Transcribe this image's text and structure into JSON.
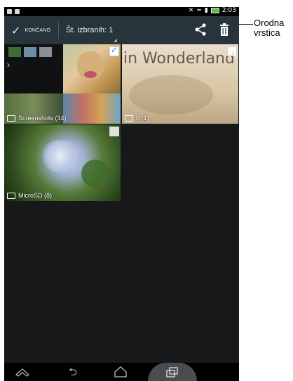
{
  "status_bar": {
    "time": "2:03"
  },
  "action_bar": {
    "done_label": "KONČANO",
    "selected_count": "Št. izbranih: 1",
    "share_icon": "share-icon",
    "delete_icon": "trash-icon"
  },
  "tiles": {
    "screenshots_label": "Screenshots (34)",
    "folder_zero_label": "0 (1)",
    "microsd_label": "MicroSD (8)",
    "wonderland_text": "in Wonderland"
  },
  "nav": {
    "back": "back-icon",
    "home": "home-icon",
    "recents": "recents-icon"
  },
  "callout": {
    "line1": "Orodna",
    "line2": "vrstica"
  }
}
